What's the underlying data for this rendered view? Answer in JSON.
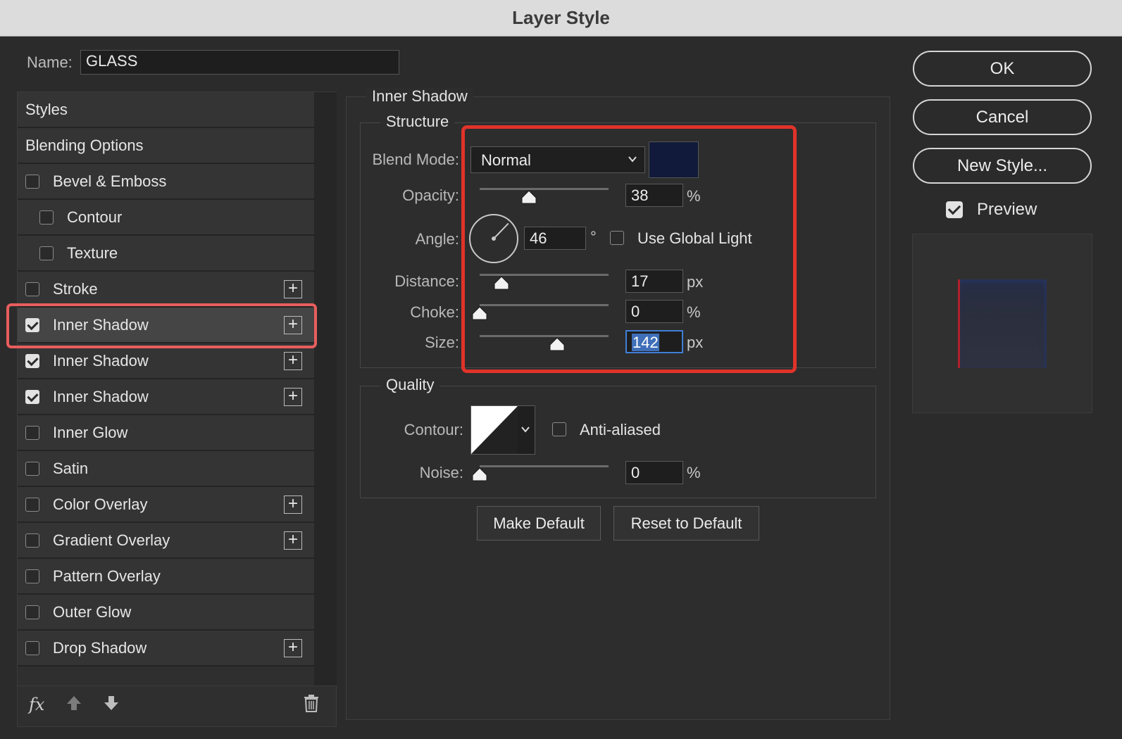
{
  "window": {
    "title": "Layer Style"
  },
  "name_field": {
    "label": "Name:",
    "value": "GLASS"
  },
  "styles_list": {
    "header_items": [
      "Styles",
      "Blending Options"
    ],
    "items": [
      {
        "label": "Bevel & Emboss",
        "checked": false,
        "indent": false,
        "has_plus": false
      },
      {
        "label": "Contour",
        "checked": false,
        "indent": true,
        "has_plus": false
      },
      {
        "label": "Texture",
        "checked": false,
        "indent": true,
        "has_plus": false
      },
      {
        "label": "Stroke",
        "checked": false,
        "indent": false,
        "has_plus": true
      },
      {
        "label": "Inner Shadow",
        "checked": true,
        "indent": false,
        "has_plus": true,
        "selected": true
      },
      {
        "label": "Inner Shadow",
        "checked": true,
        "indent": false,
        "has_plus": true
      },
      {
        "label": "Inner Shadow",
        "checked": true,
        "indent": false,
        "has_plus": true
      },
      {
        "label": "Inner Glow",
        "checked": false,
        "indent": false,
        "has_plus": false
      },
      {
        "label": "Satin",
        "checked": false,
        "indent": false,
        "has_plus": false
      },
      {
        "label": "Color Overlay",
        "checked": false,
        "indent": false,
        "has_plus": true
      },
      {
        "label": "Gradient Overlay",
        "checked": false,
        "indent": false,
        "has_plus": true
      },
      {
        "label": "Pattern Overlay",
        "checked": false,
        "indent": false,
        "has_plus": false
      },
      {
        "label": "Outer Glow",
        "checked": false,
        "indent": false,
        "has_plus": false
      },
      {
        "label": "Drop Shadow",
        "checked": false,
        "indent": false,
        "has_plus": true
      }
    ],
    "bottom_icons": {
      "fx_label": "fx",
      "move_up_icon": "arrow-up-icon",
      "move_down_icon": "arrow-down-icon",
      "delete_icon": "trash-icon"
    },
    "plus_icon": "plus-icon"
  },
  "inner_shadow": {
    "title": "Inner Shadow",
    "structure": {
      "title": "Structure",
      "blend_mode": {
        "label": "Blend Mode:",
        "value": "Normal",
        "color": "#111a3a"
      },
      "opacity": {
        "label": "Opacity:",
        "value": "38",
        "unit": "%",
        "slider_fraction": 0.38
      },
      "angle": {
        "label": "Angle:",
        "value": "46",
        "unit": "°",
        "degrees": 46
      },
      "use_global_light": {
        "label": "Use Global Light",
        "checked": false
      },
      "distance": {
        "label": "Distance:",
        "value": "17",
        "unit": "px",
        "slider_fraction": 0.17
      },
      "choke": {
        "label": "Choke:",
        "value": "0",
        "unit": "%",
        "slider_fraction": 0.0
      },
      "size": {
        "label": "Size:",
        "value": "142",
        "unit": "px",
        "slider_fraction": 0.6
      }
    },
    "quality": {
      "title": "Quality",
      "contour": {
        "label": "Contour:"
      },
      "anti_aliased": {
        "label": "Anti-aliased",
        "checked": false
      },
      "noise": {
        "label": "Noise:",
        "value": "0",
        "unit": "%",
        "slider_fraction": 0.0
      }
    },
    "buttons": {
      "make_default": "Make Default",
      "reset_default": "Reset to Default"
    }
  },
  "actions": {
    "ok": "OK",
    "cancel": "Cancel",
    "new_style": "New Style...",
    "preview_label": "Preview",
    "preview_checked": true
  },
  "colors": {
    "highlight_red": "#e0332a",
    "selection_outline": "#e85d5d",
    "focus_blue": "#3f7fd7"
  }
}
